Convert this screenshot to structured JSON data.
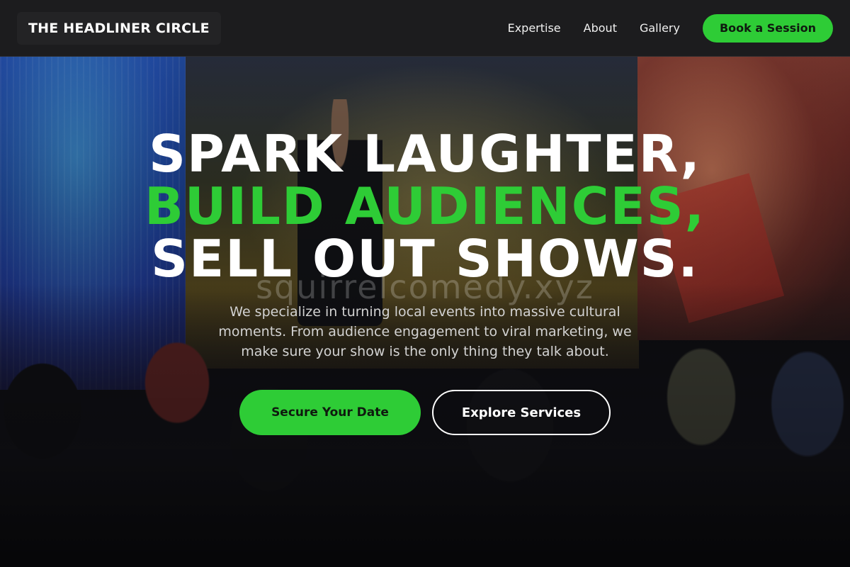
{
  "nav": {
    "brand": "THE HEADLINER CIRCLE",
    "links": [
      "Expertise",
      "About",
      "Gallery"
    ],
    "cta": "Book a Session"
  },
  "hero": {
    "headline": {
      "line1": "SPARK LAUGHTER,",
      "line2": "BUILD AUDIENCES,",
      "line3": "SELL OUT SHOWS."
    },
    "watermark": "squirrelcomedy.xyz",
    "subtext": "We specialize in turning local events into massive cultural moments. From audience engagement to viral marketing, we make sure your show is the only thing they talk about.",
    "primary_cta": "Secure Your Date",
    "secondary_cta": "Explore Services"
  },
  "colors": {
    "accent": "#2ecc36",
    "navbar": "#1c1c1e",
    "text": "#ffffff"
  }
}
